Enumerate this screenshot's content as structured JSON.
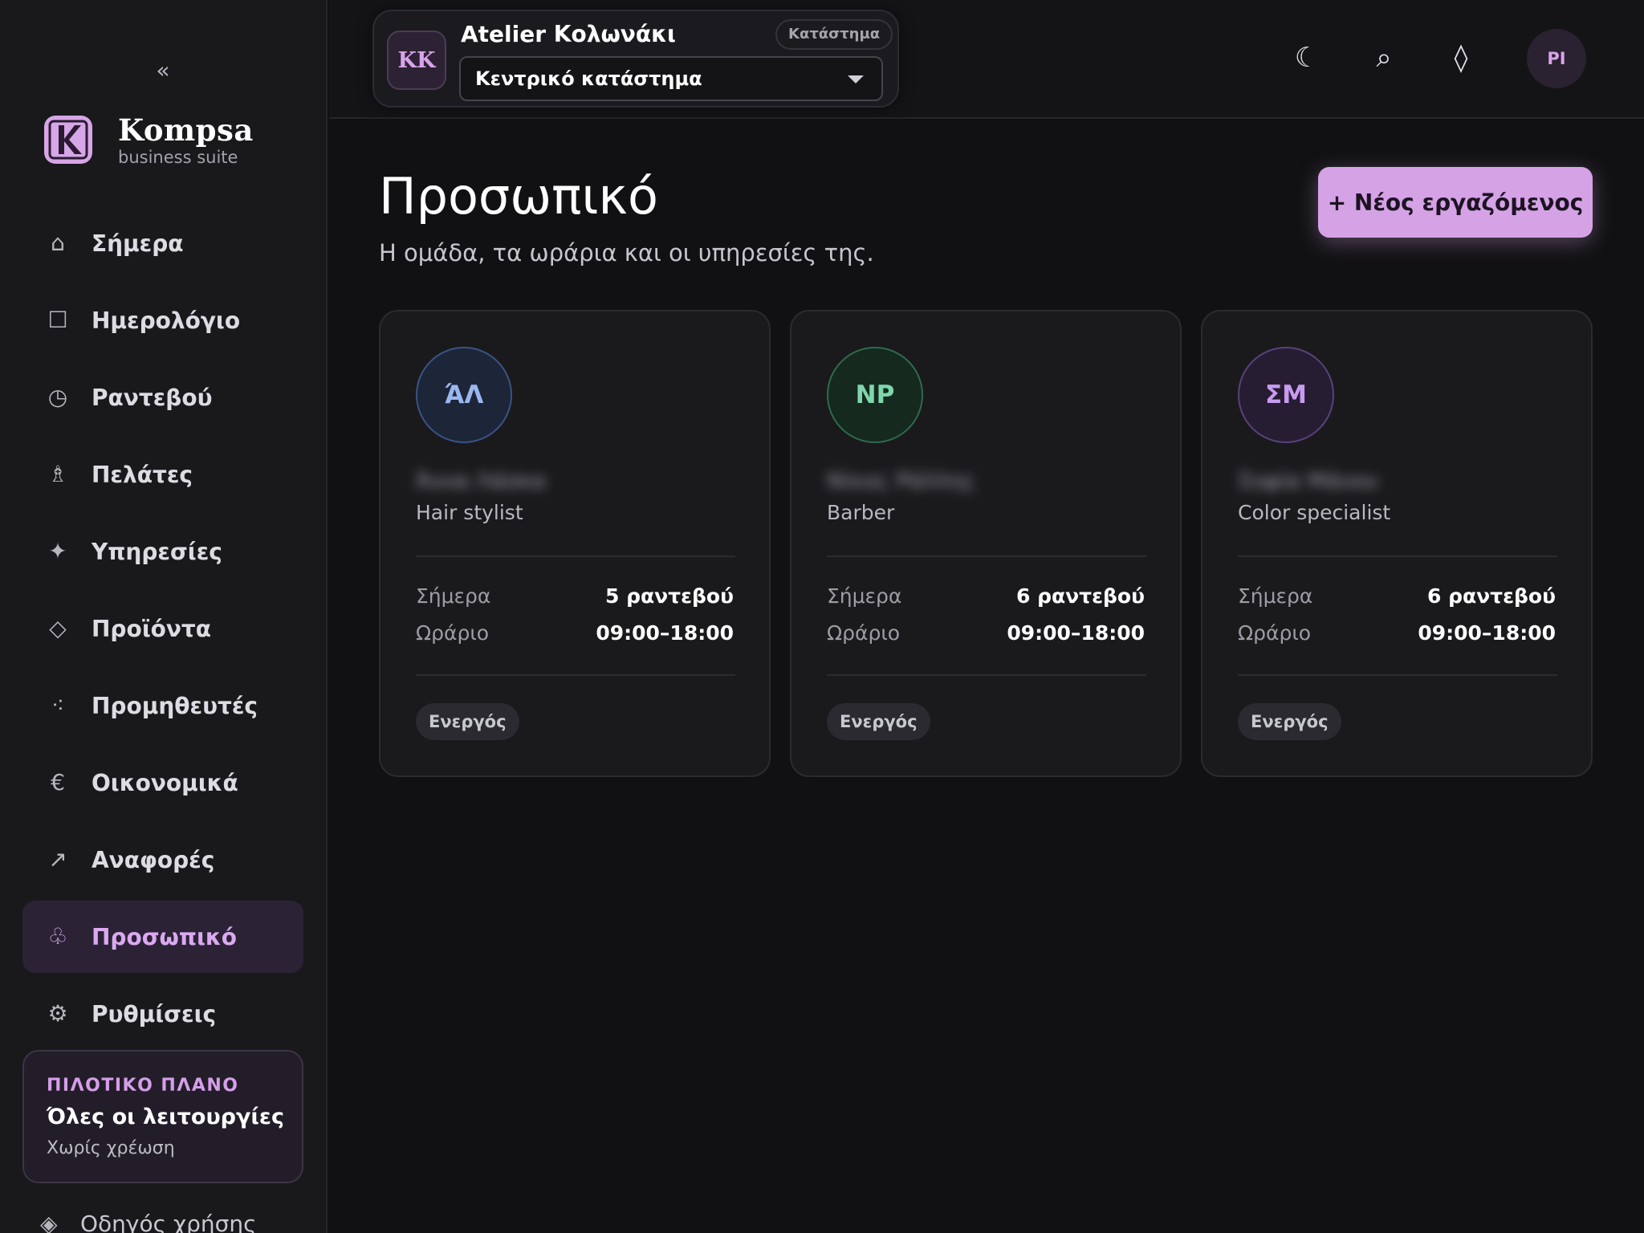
{
  "sidebar": {
    "collapse_label": "«",
    "brand": {
      "name": "Kompsa",
      "subtitle": "business suite",
      "logo_letter": "K"
    },
    "nav": [
      {
        "label": "Σήμερα",
        "icon": "home-icon",
        "glyph": "⌂",
        "active": false
      },
      {
        "label": "Ημερολόγιο",
        "icon": "calendar-icon",
        "glyph": "☐",
        "active": false
      },
      {
        "label": "Ραντεβού",
        "icon": "clock-icon",
        "glyph": "◷",
        "active": false
      },
      {
        "label": "Πελάτες",
        "icon": "person-icon",
        "glyph": "♗",
        "active": false
      },
      {
        "label": "Υπηρεσίες",
        "icon": "sparkle-icon",
        "glyph": "✦",
        "active": false
      },
      {
        "label": "Προϊόντα",
        "icon": "diamond-icon",
        "glyph": "◇",
        "active": false
      },
      {
        "label": "Προμηθευτές",
        "icon": "dots-icon",
        "glyph": "⁖",
        "active": false
      },
      {
        "label": "Οικονομικά",
        "icon": "euro-icon",
        "glyph": "€",
        "active": false
      },
      {
        "label": "Αναφορές",
        "icon": "arrow-up-right-icon",
        "glyph": "↗",
        "active": false
      },
      {
        "label": "Προσωπικό",
        "icon": "club-icon",
        "glyph": "♧",
        "active": true
      },
      {
        "label": "Ρυθμίσεις",
        "icon": "gear-icon",
        "glyph": "⚙",
        "active": false
      }
    ],
    "plan": {
      "eyebrow": "ΠΙΛΟΤΙΚΟ ΠΛΑΝΟ",
      "title": "Όλες οι λειτουργίες",
      "subtitle": "Χωρίς χρέωση"
    },
    "help": {
      "label": "Οδηγός χρήσης",
      "glyph": "◈"
    }
  },
  "topbar": {
    "store": {
      "initials": "KK",
      "name": "Atelier Κολωνάκι",
      "badge": "Κατάστημα",
      "selected": "Κεντρικό κατάστημα"
    },
    "icons": [
      {
        "name": "moon-icon",
        "glyph": "☾"
      },
      {
        "name": "search-icon",
        "glyph": "⌕"
      },
      {
        "name": "diamond-icon",
        "glyph": "◊"
      }
    ],
    "user_initials": "PI"
  },
  "main": {
    "title": "Προσωπικό",
    "subtitle": "Η ομάδα, τα ωράρια και οι υπηρεσίες της.",
    "new_button": "+ Νέος εργαζόμενος",
    "staff": [
      {
        "initials": "ΆΛ",
        "name": "Άννα Λάσκα",
        "role": "Hair stylist",
        "today_label": "Σήμερα",
        "today_value": "5 ραντεβού",
        "hours_label": "Ωράριο",
        "hours_value": "09:00–18:00",
        "status": "Ενεργός",
        "avatar_bg": "#1c2638",
        "avatar_border": "#3a5384",
        "avatar_text": "#9bb7ef"
      },
      {
        "initials": "NP",
        "name": "Νίκος Ράλλης",
        "role": "Barber",
        "today_label": "Σήμερα",
        "today_value": "6 ραντεβού",
        "hours_label": "Ωράριο",
        "hours_value": "09:00–18:00",
        "status": "Ενεργός",
        "avatar_bg": "#15291f",
        "avatar_border": "#2f6a4d",
        "avatar_text": "#7fd6ab"
      },
      {
        "initials": "ΣΜ",
        "name": "Σοφία Μάνου",
        "role": "Color specialist",
        "today_label": "Σήμερα",
        "today_value": "6 ραντεβού",
        "hours_label": "Ωράριο",
        "hours_value": "09:00–18:00",
        "status": "Ενεργός",
        "avatar_bg": "#271d33",
        "avatar_border": "#58427a",
        "avatar_text": "#c79cf0"
      }
    ]
  },
  "colors": {
    "accent": "#d5a2e6",
    "background": "#111113",
    "sidebar": "#19191c",
    "card": "#1a1a1d"
  }
}
